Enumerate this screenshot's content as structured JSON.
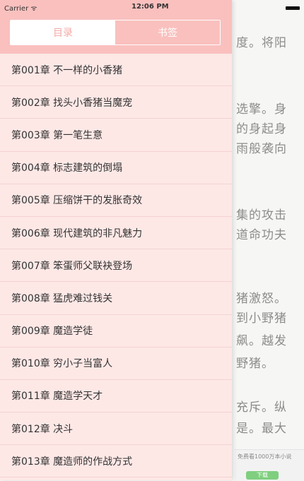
{
  "status_bar": {
    "carrier": "Carrier ᯤ",
    "time": "12:06 PM"
  },
  "tabs": [
    {
      "label": "目录",
      "active": true
    },
    {
      "label": "书签",
      "active": false
    }
  ],
  "chapters": [
    "第001章 不一样的小香猪",
    "第002章 找头小香猪当魔宠",
    "第003章 第一笔生意",
    "第004章 标志建筑的倒塌",
    "第005章 压缩饼干的发胀奇效",
    "第006章 现代建筑的非凡魅力",
    "第007章 笨蛋师父联袂登场",
    "第008章 猛虎难过钱关",
    "第009章 魔造学徒",
    "第010章 穷小子当富人",
    "第011章 魔造学天才",
    "第012章 决斗",
    "第013章 魔造师的作战方式"
  ],
  "reader_text": [
    "度。将阳",
    "选擎。身",
    "的身起身",
    "雨般袭向",
    "集的攻击",
    "道命功夫",
    "猪激怒。",
    "到小野猪",
    "飙。越发",
    "野猪。",
    "充斥。纵",
    "是。最大"
  ],
  "banner": {
    "text": "免费看1000万本小说",
    "button": "下载"
  },
  "colors": {
    "header": "#f9c0be",
    "drawer": "#fde8e6",
    "tab_text": "#f4aaa8"
  }
}
